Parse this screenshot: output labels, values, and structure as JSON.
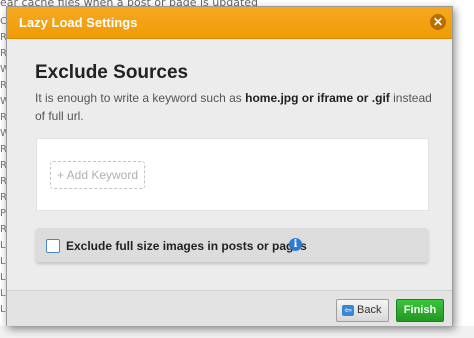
{
  "background": {
    "top_text": "ear cache files when a post or page is updated",
    "side_fragments": [
      "C",
      "R",
      "R",
      "W",
      "R",
      "W",
      "R",
      "W",
      "R",
      "R",
      "R",
      "R",
      "P",
      "R",
      "L",
      "L",
      "L",
      "L",
      "L"
    ]
  },
  "dialog": {
    "title": "Lazy Load Settings",
    "close_icon": "close-icon",
    "section_title": "Exclude Sources",
    "description": {
      "part1": "It is enough to write a keyword such as ",
      "bold": "home.jpg or iframe or .gif",
      "part2": " instead of full url."
    },
    "add_keyword_label": "+ Add Keyword",
    "exclude_full_size_label": "Exclude full size images in posts or pages",
    "exclude_full_size_checked": false,
    "info_icon": "info-icon"
  },
  "footer": {
    "back_label": "Back",
    "finish_label": "Finish"
  },
  "colors": {
    "header": "#f39f0a",
    "finish": "#2aa52a",
    "info": "#2a7bd4"
  }
}
